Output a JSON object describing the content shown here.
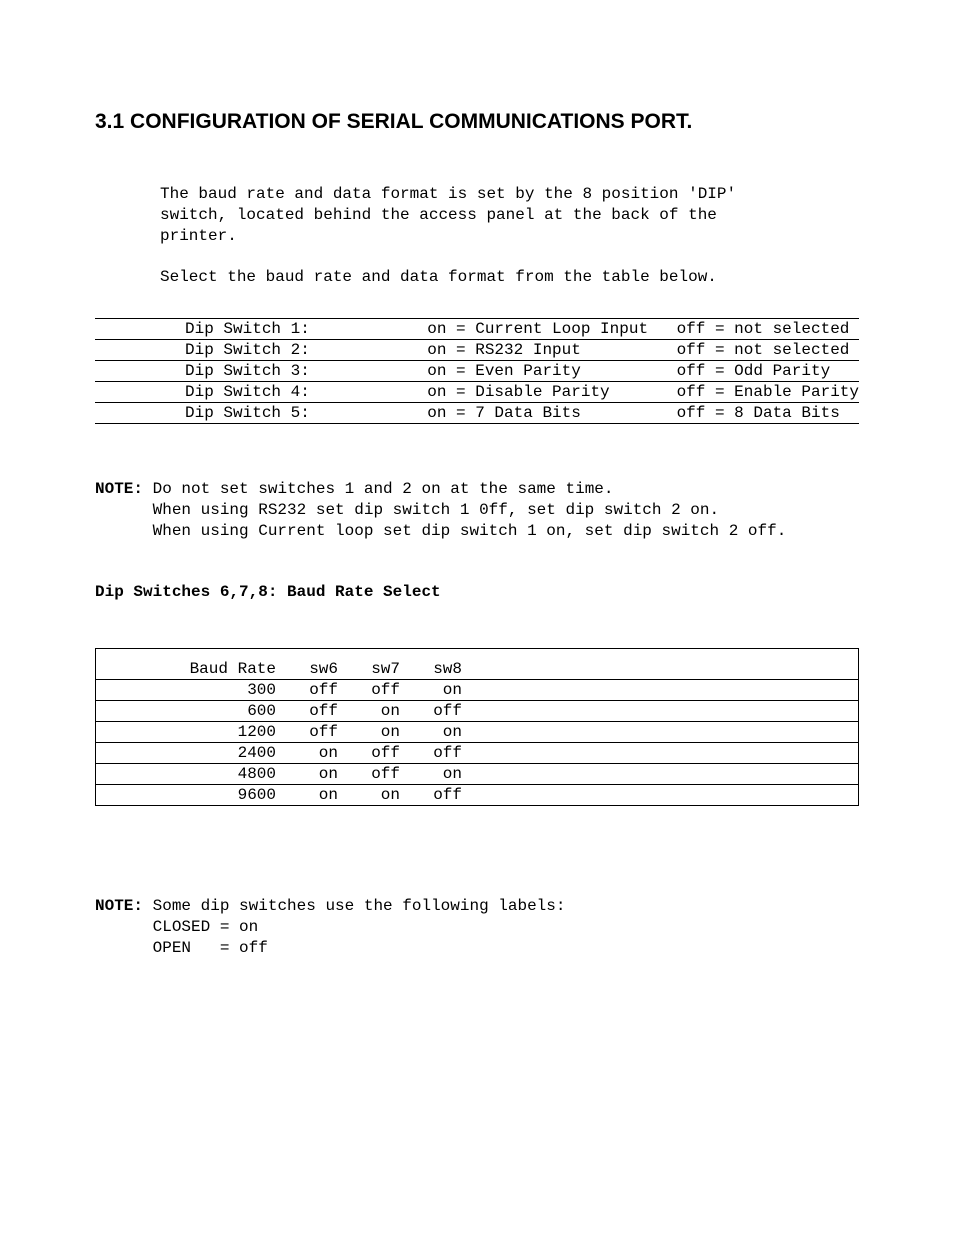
{
  "heading": "3.1  CONFIGURATION OF SERIAL COMMUNICATIONS PORT.",
  "para1": "The baud rate and data format is set by the 8 position 'DIP'\nswitch, located behind the access panel at the back of the\nprinter.",
  "para2": "Select the baud rate and data format from the table below.",
  "switch_table": [
    {
      "label": "Dip Switch 1:",
      "on": "on = Current Loop Input",
      "off": "off = not selected"
    },
    {
      "label": "Dip Switch 2:",
      "on": "on = RS232 Input",
      "off": "off = not selected"
    },
    {
      "label": "Dip Switch 3:",
      "on": "on = Even Parity",
      "off": "off = Odd Parity"
    },
    {
      "label": "Dip Switch 4:",
      "on": "on = Disable Parity",
      "off": "off = Enable Parity"
    },
    {
      "label": "Dip Switch 5:",
      "on": "on = 7 Data Bits",
      "off": "off = 8 Data Bits"
    }
  ],
  "note1_label": "NOTE:",
  "note1_body": " Do not set switches 1 and 2 on at the same time.\n      When using RS232 set dip switch 1 0ff, set dip switch 2 on.\n      When using Current loop set dip switch 1 on, set dip switch 2 off.",
  "subheading": "Dip Switches 6,7,8: Baud Rate Select",
  "baud_header": {
    "rate": "Baud Rate",
    "sw6": "sw6",
    "sw7": "sw7",
    "sw8": "sw8"
  },
  "baud_rows": [
    {
      "rate": "300",
      "sw6": "off",
      "sw7": "off",
      "sw8": "on"
    },
    {
      "rate": "600",
      "sw6": "off",
      "sw7": "on",
      "sw8": "off"
    },
    {
      "rate": "1200",
      "sw6": "off",
      "sw7": "on",
      "sw8": "on"
    },
    {
      "rate": "2400",
      "sw6": "on",
      "sw7": "off",
      "sw8": "off"
    },
    {
      "rate": "4800",
      "sw6": "on",
      "sw7": "off",
      "sw8": "on"
    },
    {
      "rate": "9600",
      "sw6": "on",
      "sw7": "on",
      "sw8": "off"
    }
  ],
  "note2_label": "NOTE:",
  "note2_body": " Some dip switches use the following labels:\n      CLOSED = on\n      OPEN   = off"
}
